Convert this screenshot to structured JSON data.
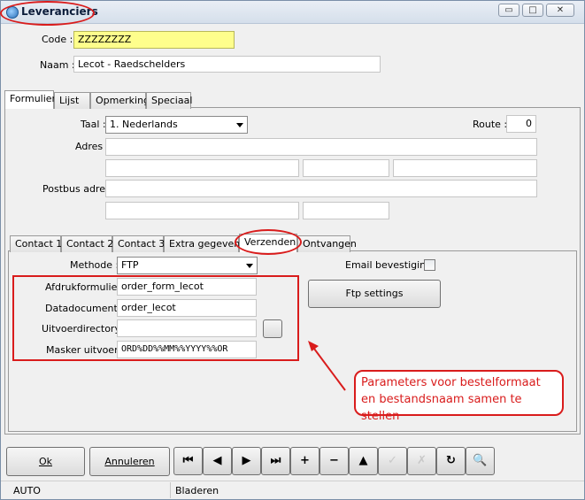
{
  "window": {
    "title": "Leveranciers",
    "controls": {
      "minimize": "▭",
      "maximize": "□",
      "close": "✕"
    }
  },
  "header": {
    "code_label": "Code :",
    "code_value": "ZZZZZZZZ",
    "naam_label": "Naam :",
    "naam_value": "Lecot - Raedschelders"
  },
  "main_tabs": [
    "Formulier",
    "Lijst",
    "Opmerking",
    "Speciaal"
  ],
  "formulier": {
    "taal_label": "Taal :",
    "taal_value": "1.  Nederlands",
    "route_label": "Route :",
    "route_value": "0",
    "adres_label": "Adres :",
    "postbus_label": "Postbus adres:"
  },
  "sub_tabs": [
    "Contact 1",
    "Contact 2",
    "Contact 3",
    "Extra gegevens",
    "Verzenden",
    "Ontvangen"
  ],
  "verzenden": {
    "methode_label": "Methode :",
    "methode_value": "FTP",
    "email_label": "Email bevestiging",
    "ftp_button": "Ftp settings",
    "afdruk_label": "Afdrukformulier :",
    "afdruk_value": "order_form_lecot",
    "data_label": "Datadocument :",
    "data_value": "order_lecot",
    "uitvoer_label": "Uitvoerdirectory :",
    "uitvoer_value": "",
    "masker_label": "Masker uitvoer :",
    "masker_value": "ORD%DD%%MM%%YYYY%%OR"
  },
  "callout": {
    "text": "Parameters voor bestelformaat en bestandsnaam samen te stellen"
  },
  "footer": {
    "ok_label": "Ok",
    "annuleren_label": "Annuleren"
  },
  "status": {
    "left": "AUTO",
    "middle": "Bladeren"
  },
  "colors": {
    "annotation": "#d91c1c",
    "code_field": "#fefe8c"
  }
}
